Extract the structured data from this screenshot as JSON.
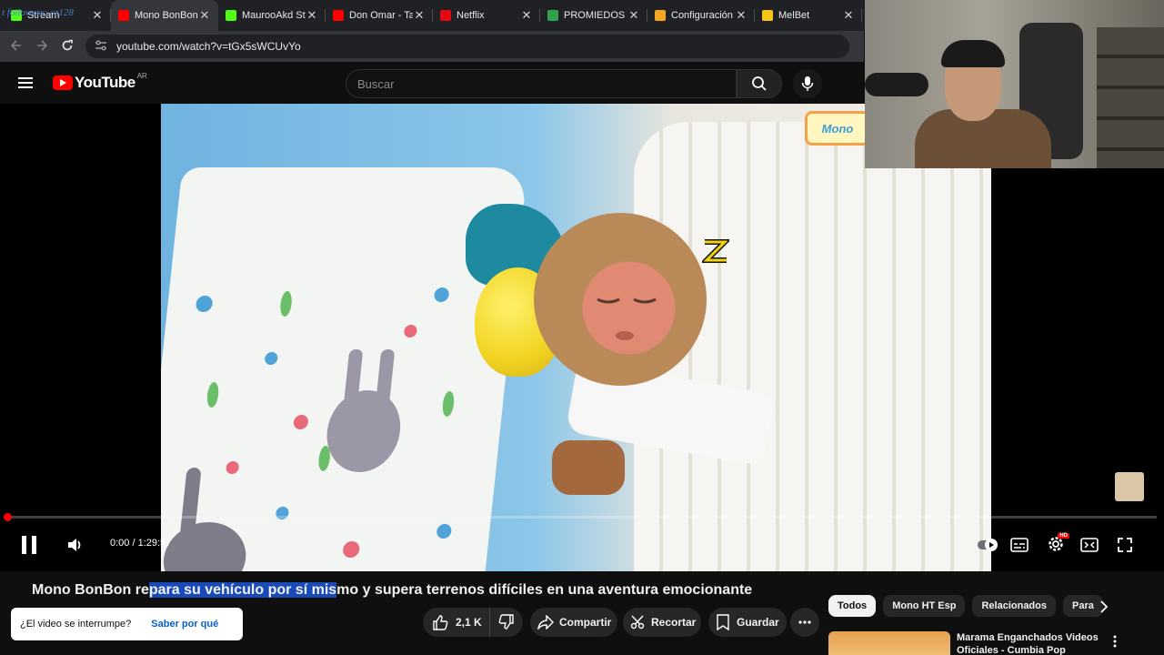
{
  "browser": {
    "tabs": [
      {
        "title": "Stream",
        "favicon_color": "#53fc18",
        "active": false
      },
      {
        "title": "Mono BonBon",
        "favicon_color": "#ff0000",
        "active": true
      },
      {
        "title": "MaurooAkd St",
        "favicon_color": "#53fc18",
        "active": false
      },
      {
        "title": "Don Omar - Ta",
        "favicon_color": "#ff0000",
        "active": false
      },
      {
        "title": "Netflix",
        "favicon_color": "#e50914",
        "active": false
      },
      {
        "title": "PROMIEDOS -",
        "favicon_color": "#2ea44f",
        "active": false
      },
      {
        "title": "Configuración",
        "favicon_color": "#f4a623",
        "active": false
      },
      {
        "title": "MelBet",
        "favicon_color": "#f5c518",
        "active": false
      }
    ],
    "overlay_text": "t followers: cz128",
    "url": "youtube.com/watch?v=tGx5sWCUvYo"
  },
  "youtube": {
    "logo_text": "YouTube",
    "region": "AR",
    "search_placeholder": "Buscar"
  },
  "video": {
    "corner_tag": "Mono",
    "time_display": "0:00 / 1:29:57",
    "progress_fraction": 0.003
  },
  "below_video": {
    "title_before": "Mono BonBon re",
    "title_highlight": "para su vehículo por sí mis",
    "title_after": "mo y supera terrenos difíciles en una aventura emocionante",
    "likes": "2,1 K",
    "share_label": "Compartir",
    "clip_label": "Recortar",
    "save_label": "Guardar",
    "toast_text": "¿El video se interrumpe?",
    "toast_link": "Saber por qué"
  },
  "related": {
    "chips": [
      "Todos",
      "Mono HT Esp",
      "Relacionados",
      "Para"
    ],
    "first_video_title": "Marama Enganchados Videos Oficiales - Cumbia Pop"
  },
  "colors": {
    "accent_red": "#ff0000",
    "highlight_blue": "#1a4ab8",
    "link_blue": "#065fd4"
  }
}
